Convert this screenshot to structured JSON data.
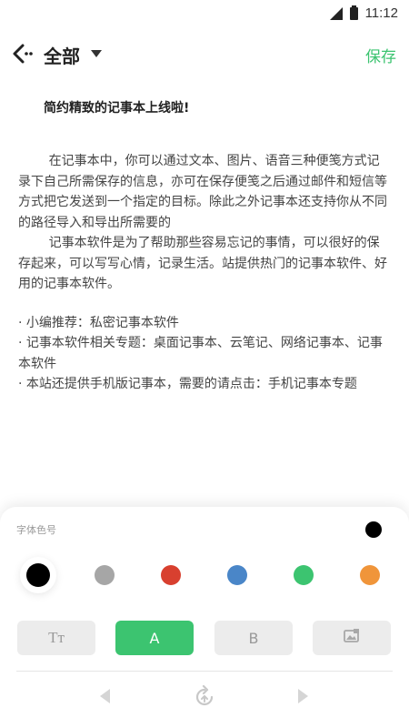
{
  "status_bar": {
    "time": "11:12"
  },
  "header": {
    "title": "全部",
    "save_label": "保存"
  },
  "document": {
    "title": "简约精致的记事本上线啦!",
    "paragraphs": [
      "在记事本中，你可以通过文本、图片、语音三种便笺方式记录下自己所需保存的信息，亦可在保存便笺之后通过邮件和短信等方式把它发送到一个指定的目标。除此之外记事本还支持你从不同的路径导入和导出所需要的",
      "记事本软件是为了帮助那些容易忘记的事情，可以很好的保存起来，可以写写心情，记录生活。站提供热门的记事本软件、好用的记事本软件。"
    ],
    "bullets": [
      "· 小编推荐：私密记事本软件",
      "· 记事本软件相关专题：桌面记事本、云笔记、网络记事本、记事本软件",
      "· 本站还提供手机版记事本，需要的请点击：手机记事本专题"
    ]
  },
  "panel": {
    "label": "字体色号",
    "current_color": "#000000",
    "colors": [
      "#000000",
      "#a6a6a6",
      "#d8402f",
      "#4a86c8",
      "#3cc470",
      "#f0953a"
    ],
    "selected_color_index": 0,
    "tools": [
      {
        "name": "font-size",
        "label": "Tт",
        "icon": "text-size-icon",
        "active": false
      },
      {
        "name": "color-a",
        "label": "A",
        "icon": "",
        "active": true
      },
      {
        "name": "bold-b",
        "label": "B",
        "icon": "",
        "active": false
      },
      {
        "name": "image",
        "label": "",
        "icon": "image-icon",
        "active": false
      }
    ]
  },
  "colors": {
    "accent": "#3cc470"
  }
}
